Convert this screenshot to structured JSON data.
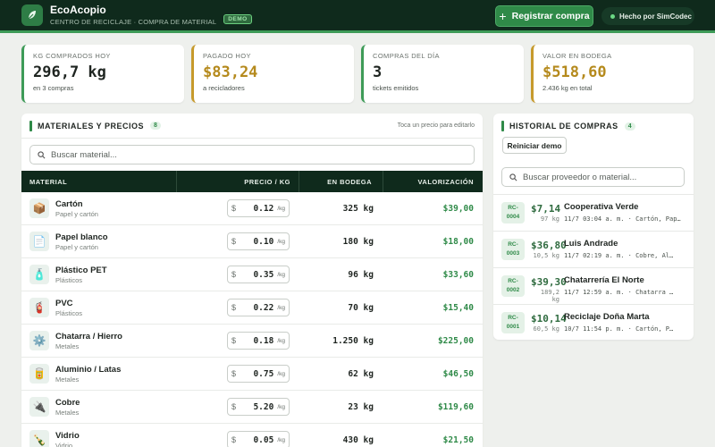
{
  "header": {
    "app_name": "EcoAcopio",
    "subtitle": "CENTRO DE RECICLAJE · COMPRA DE MATERIAL",
    "badge": "DEMO",
    "register_button": "Registrar compra",
    "made_by": "Hecho por SimCodec",
    "colors": {
      "bar": "#0f2a1c",
      "accent": "#2f8a48"
    }
  },
  "stats": [
    {
      "label": "KG COMPRADOS HOY",
      "value": "296,7 kg",
      "sub": "en 3 compras",
      "accent": "green"
    },
    {
      "label": "PAGADO HOY",
      "value": "$83,24",
      "sub": "a recicladores",
      "accent": "gold"
    },
    {
      "label": "COMPRAS DEL DÍA",
      "value": "3",
      "sub": "tickets emitidos",
      "accent": "green"
    },
    {
      "label": "VALOR EN BODEGA",
      "value": "$518,60",
      "sub": "2.436 kg en total",
      "accent": "gold"
    }
  ],
  "materials": {
    "title": "MATERIALES Y PRECIOS",
    "count": "8",
    "hint": "Toca un precio para editarlo",
    "search_placeholder": "Buscar material...",
    "columns": {
      "material": "MATERIAL",
      "price": "PRECIO / KG",
      "stock": "EN BODEGA",
      "valuation": "VALORIZACIÓN"
    },
    "currency": "$",
    "unit": "/kg",
    "rows": [
      {
        "name": "Cartón",
        "category": "Papel y cartón",
        "icon": "box-icon",
        "glyph": "📦",
        "price": "0.12",
        "stock": "325 kg",
        "valuation": "$39,00"
      },
      {
        "name": "Papel blanco",
        "category": "Papel y cartón",
        "icon": "paper-icon",
        "glyph": "📄",
        "price": "0.10",
        "stock": "180 kg",
        "valuation": "$18,00"
      },
      {
        "name": "Plástico PET",
        "category": "Plásticos",
        "icon": "bottle-icon",
        "glyph": "🧴",
        "price": "0.35",
        "stock": "96 kg",
        "valuation": "$33,60"
      },
      {
        "name": "PVC",
        "category": "Plásticos",
        "icon": "extinguisher-icon",
        "glyph": "🧯",
        "price": "0.22",
        "stock": "70 kg",
        "valuation": "$15,40"
      },
      {
        "name": "Chatarra / Hierro",
        "category": "Metales",
        "icon": "gear-icon",
        "glyph": "⚙️",
        "price": "0.18",
        "stock": "1.250 kg",
        "valuation": "$225,00"
      },
      {
        "name": "Aluminio / Latas",
        "category": "Metales",
        "icon": "can-icon",
        "glyph": "🥫",
        "price": "0.75",
        "stock": "62 kg",
        "valuation": "$46,50"
      },
      {
        "name": "Cobre",
        "category": "Metales",
        "icon": "plug-icon",
        "glyph": "🔌",
        "price": "5.20",
        "stock": "23 kg",
        "valuation": "$119,60"
      },
      {
        "name": "Vidrio",
        "category": "Vidrio",
        "icon": "glass-bottle-icon",
        "glyph": "🍾",
        "price": "0.05",
        "stock": "430 kg",
        "valuation": "$21,50"
      }
    ]
  },
  "history": {
    "title": "HISTORIAL DE COMPRAS",
    "count": "4",
    "reset_button": "Reiniciar demo",
    "search_placeholder": "Buscar proveedor o material...",
    "items": [
      {
        "code_a": "RC-",
        "code_b": "0004",
        "amount": "$7,14",
        "kg": "97 kg",
        "name": "Cooperativa Verde",
        "meta": "11/7 03:04 a. m. · Cartón, Pap…"
      },
      {
        "code_a": "RC-",
        "code_b": "0003",
        "amount": "$36,80",
        "kg": "10,5 kg",
        "name": "Luis Andrade",
        "meta": "11/7 02:19 a. m. · Cobre, Al…"
      },
      {
        "code_a": "RC-",
        "code_b": "0002",
        "amount": "$39,30",
        "kg": "189,2 kg",
        "name": "Chatarrería El Norte",
        "meta": "11/7 12:59 a. m. · Chatarra …"
      },
      {
        "code_a": "RC-",
        "code_b": "0001",
        "amount": "$10,14",
        "kg": "60,5 kg",
        "name": "Reciclaje Doña Marta",
        "meta": "10/7 11:54 p. m. · Cartón, P…"
      }
    ]
  }
}
